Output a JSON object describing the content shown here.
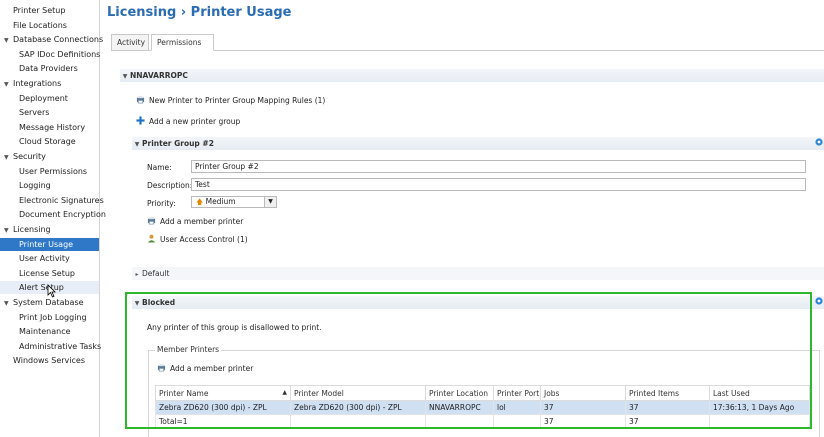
{
  "sidebar": {
    "items": [
      {
        "label": "Printer Setup",
        "level": 0
      },
      {
        "label": "File Locations",
        "level": 0
      },
      {
        "label": "Database Connections",
        "level": 0,
        "expanded": true
      },
      {
        "label": "SAP IDoc Definitions",
        "level": 1
      },
      {
        "label": "Data Providers",
        "level": 1
      },
      {
        "label": "Integrations",
        "level": 0,
        "expanded": true
      },
      {
        "label": "Deployment",
        "level": 1
      },
      {
        "label": "Servers",
        "level": 1
      },
      {
        "label": "Message History",
        "level": 1
      },
      {
        "label": "Cloud Storage",
        "level": 1
      },
      {
        "label": "Security",
        "level": 0,
        "expanded": true
      },
      {
        "label": "User Permissions",
        "level": 1
      },
      {
        "label": "Logging",
        "level": 1
      },
      {
        "label": "Electronic Signatures",
        "level": 1
      },
      {
        "label": "Document Encryption",
        "level": 1
      },
      {
        "label": "Licensing",
        "level": 0,
        "expanded": true
      },
      {
        "label": "Printer Usage",
        "level": 1,
        "selected": true
      },
      {
        "label": "User Activity",
        "level": 1
      },
      {
        "label": "License Setup",
        "level": 1
      },
      {
        "label": "Alert Setup",
        "level": 1,
        "hover": true
      },
      {
        "label": "System Database",
        "level": 0,
        "expanded": true
      },
      {
        "label": "Print Job Logging",
        "level": 1
      },
      {
        "label": "Maintenance",
        "level": 1
      },
      {
        "label": "Administrative Tasks",
        "level": 1
      },
      {
        "label": "Windows Services",
        "level": 0
      }
    ]
  },
  "header": {
    "title": "Licensing › Printer Usage"
  },
  "tabs": [
    {
      "label": "Activity"
    },
    {
      "label": "Permissions",
      "active": true
    }
  ],
  "server": {
    "name": "NNAVARROPC",
    "mapping_rules": "New Printer to Printer Group Mapping Rules (1)",
    "add_group": "Add a new printer group"
  },
  "group2": {
    "header": "Printer Group #2",
    "name_label": "Name:",
    "name_value": "Printer Group #2",
    "desc_label": "Description:",
    "desc_value": "Test",
    "priority_label": "Priority:",
    "priority_value": "Medium",
    "add_member": "Add a member printer",
    "uac": "User Access Control (1)"
  },
  "default_group": {
    "header": "Default"
  },
  "blocked": {
    "header": "Blocked",
    "description": "Any printer of this group is disallowed to print.",
    "member_printers": "Member Printers",
    "add_member": "Add a member printer",
    "columns": [
      "Printer Name",
      "Printer Model",
      "Printer Location",
      "Printer Port",
      "Jobs",
      "Printed Items",
      "Last Used"
    ],
    "rows": [
      [
        "Zebra ZD620 (300 dpi) - ZPL",
        "Zebra ZD620 (300 dpi) - ZPL",
        "NNAVARROPC",
        "lol",
        "37",
        "37",
        "17:36:13, 1 Days Ago"
      ]
    ],
    "totals": [
      "Total=1",
      "",
      "",
      "",
      "37",
      "37",
      ""
    ]
  },
  "colors": {
    "accent": "#2a6db2",
    "selection": "#2e78c7",
    "highlight_border": "#2eb82e"
  },
  "icons": {
    "add": "plus-icon",
    "printer": "printer-icon",
    "user": "user-icon",
    "settings": "gear-icon",
    "priority": "up-arrow-icon"
  }
}
